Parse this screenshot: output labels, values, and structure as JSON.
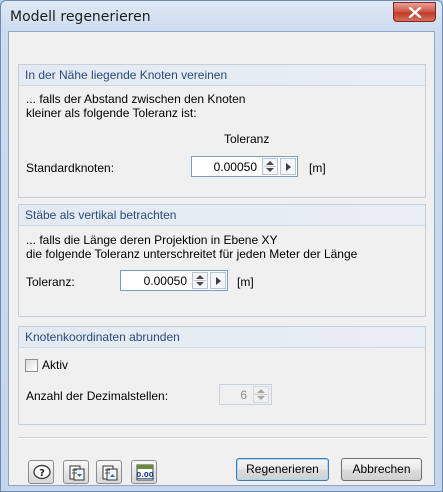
{
  "window": {
    "title": "Modell regenerieren",
    "close_label": "X"
  },
  "group_nodes": {
    "header": "In der Nähe liegende Knoten vereinen",
    "desc_line1": "... falls der Abstand zwischen den Knoten",
    "desc_line2": "kleiner als folgende Toleranz ist:",
    "column_label": "Toleranz",
    "field_label": "Standardknoten:",
    "value": "0.00050",
    "unit": "[m]"
  },
  "group_members": {
    "header": "Stäbe als vertikal betrachten",
    "desc_line1": "... falls die Länge deren Projektion in Ebene XY",
    "desc_line2": "die folgende Toleranz unterschreitet für jeden Meter der Länge",
    "field_label": "Toleranz:",
    "value": "0.00050",
    "unit": "[m]"
  },
  "group_round": {
    "header": "Knotenkoordinaten abrunden",
    "checkbox_label": "Aktiv",
    "checkbox_checked": false,
    "decimals_label": "Anzahl der Dezimalstellen:",
    "decimals_value": "6"
  },
  "footer": {
    "icon_buttons": [
      "help-icon",
      "import-icon",
      "export-icon",
      "units-icon"
    ],
    "units_icon_text": "0.00",
    "regenerate_label": "Regenerieren",
    "cancel_label": "Abbrechen"
  },
  "colors": {
    "group_header_text": "#2b4a7a",
    "close_button": "#c94b3a",
    "default_button_border": "#3c7fb1"
  }
}
